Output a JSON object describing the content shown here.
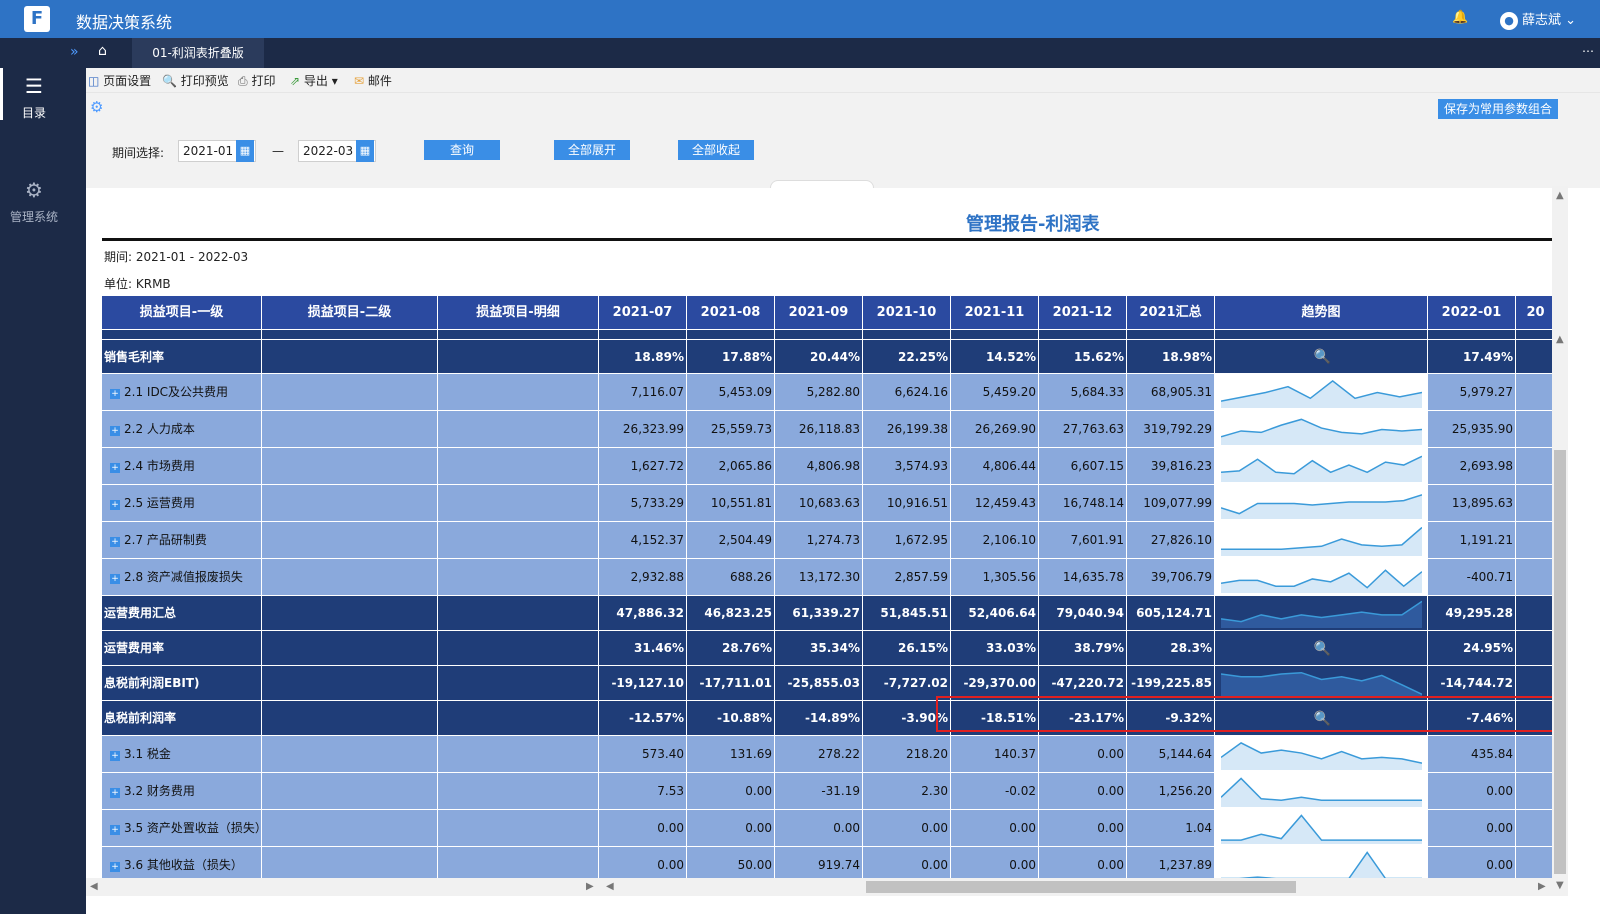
{
  "app": {
    "title": "数据决策系统",
    "logo": "F",
    "user": "薛志斌"
  },
  "sidebar": {
    "items": [
      {
        "label": "目录",
        "icon": "list-icon"
      },
      {
        "label": "管理系统",
        "icon": "gear-icon"
      }
    ]
  },
  "tabs": {
    "active": "01-利润表折叠版"
  },
  "toolbar": {
    "page_setup": "页面设置",
    "print_preview": "打印预览",
    "print": "打印",
    "export": "导出",
    "mail": "邮件"
  },
  "params": {
    "label": "期间选择:",
    "start": "2021-01",
    "separator": "—",
    "end": "2022-03",
    "query": "查询",
    "expand_all": "全部展开",
    "collapse_all": "全部收起",
    "save": "保存为常用参数组合"
  },
  "report": {
    "title": "管理报告-利润表",
    "period": "期间:  2021-01 - 2022-03",
    "unit": "单位:  KRMB",
    "headers": [
      "损益项目-一级",
      "损益项目-二级",
      "损益项目-明细",
      "2021-07",
      "2021-08",
      "2021-09",
      "2021-10",
      "2021-11",
      "2021-12",
      "2021汇总",
      "趋势图",
      "2022-01",
      "20"
    ],
    "rows": [
      {
        "type": "dark",
        "label": "销售毛利率",
        "values": [
          "18.89%",
          "17.88%",
          "20.44%",
          "22.25%",
          "14.52%",
          "15.62%",
          "18.98%"
        ],
        "next": "17.49%",
        "trend": "none"
      },
      {
        "type": "light",
        "label": "2.1 IDC及公共费用",
        "values": [
          "7,116.07",
          "5,453.09",
          "5,282.80",
          "6,624.16",
          "5,459.20",
          "5,684.33",
          "68,905.31"
        ],
        "next": "5,979.27",
        "trend": "area"
      },
      {
        "type": "light",
        "label": "2.2 人力成本",
        "values": [
          "26,323.99",
          "25,559.73",
          "26,118.83",
          "26,199.38",
          "26,269.90",
          "27,763.63",
          "319,792.29"
        ],
        "next": "25,935.90",
        "trend": "area"
      },
      {
        "type": "light",
        "label": "2.4 市场费用",
        "values": [
          "1,627.72",
          "2,065.86",
          "4,806.98",
          "3,574.93",
          "4,806.44",
          "6,607.15",
          "39,816.23"
        ],
        "next": "2,693.98",
        "trend": "area"
      },
      {
        "type": "light",
        "label": "2.5 运营费用",
        "values": [
          "5,733.29",
          "10,551.81",
          "10,683.63",
          "10,916.51",
          "12,459.43",
          "16,748.14",
          "109,077.99"
        ],
        "next": "13,895.63",
        "trend": "area"
      },
      {
        "type": "light",
        "label": "2.7 产品研制费",
        "values": [
          "4,152.37",
          "2,504.49",
          "1,274.73",
          "1,672.95",
          "2,106.10",
          "7,601.91",
          "27,826.10"
        ],
        "next": "1,191.21",
        "trend": "area"
      },
      {
        "type": "light",
        "label": "2.8 资产减值报废损失",
        "values": [
          "2,932.88",
          "688.26",
          "13,172.30",
          "2,857.59",
          "1,305.56",
          "14,635.78",
          "39,706.79"
        ],
        "next": "-400.71",
        "trend": "area"
      },
      {
        "type": "dark",
        "label": "运营费用汇总",
        "values": [
          "47,886.32",
          "46,823.25",
          "61,339.27",
          "51,845.51",
          "52,406.64",
          "79,040.94",
          "605,124.71"
        ],
        "next": "49,295.28",
        "trend": "area"
      },
      {
        "type": "dark",
        "label": "运营费用率",
        "values": [
          "31.46%",
          "28.76%",
          "35.34%",
          "26.15%",
          "33.03%",
          "38.79%",
          "28.3%"
        ],
        "next": "24.95%",
        "trend": "none"
      },
      {
        "type": "dark",
        "label": "息税前利润EBIT)",
        "values": [
          "-19,127.10",
          "-17,711.01",
          "-25,855.03",
          "-7,727.02",
          "-29,370.00",
          "-47,220.72",
          "-199,225.85"
        ],
        "next": "-14,744.72",
        "trend": "area"
      },
      {
        "type": "dark",
        "label": "息税前利润率",
        "values": [
          "-12.57%",
          "-10.88%",
          "-14.89%",
          "-3.90%",
          "-18.51%",
          "-23.17%",
          "-9.32%"
        ],
        "next": "-7.46%",
        "trend": "none"
      },
      {
        "type": "light",
        "label": "3.1 税金",
        "values": [
          "573.40",
          "131.69",
          "278.22",
          "218.20",
          "140.37",
          "0.00",
          "5,144.64"
        ],
        "next": "435.84",
        "trend": "area"
      },
      {
        "type": "light",
        "label": "3.2 财务费用",
        "values": [
          "7.53",
          "0.00",
          "-31.19",
          "2.30",
          "-0.02",
          "0.00",
          "1,256.20"
        ],
        "next": "0.00",
        "trend": "area"
      },
      {
        "type": "light",
        "label": "3.5 资产处置收益（损失）",
        "values": [
          "0.00",
          "0.00",
          "0.00",
          "0.00",
          "0.00",
          "0.00",
          "1.04"
        ],
        "next": "0.00",
        "trend": "area"
      },
      {
        "type": "light",
        "label": "3.6 其他收益（损失）",
        "values": [
          "0.00",
          "50.00",
          "919.74",
          "0.00",
          "0.00",
          "0.00",
          "1,237.89"
        ],
        "next": "0.00",
        "trend": "area"
      }
    ],
    "trend_series": [
      [],
      [
        0.2,
        0.35,
        0.5,
        0.7,
        0.3,
        0.9,
        0.3,
        0.5,
        0.35,
        0.5
      ],
      [
        0.25,
        0.45,
        0.4,
        0.65,
        0.85,
        0.55,
        0.4,
        0.35,
        0.5,
        0.45,
        0.5
      ],
      [
        0.3,
        0.35,
        0.75,
        0.3,
        0.25,
        0.7,
        0.3,
        0.55,
        0.3,
        0.65,
        0.55,
        0.85
      ],
      [
        0.35,
        0.15,
        0.5,
        0.5,
        0.5,
        0.45,
        0.5,
        0.55,
        0.55,
        0.55,
        0.6,
        0.8
      ],
      [
        0.2,
        0.2,
        0.2,
        0.2,
        0.25,
        0.3,
        0.55,
        0.35,
        0.3,
        0.35,
        0.95
      ],
      [
        0.3,
        0.4,
        0.4,
        0.2,
        0.2,
        0.45,
        0.35,
        0.65,
        0.15,
        0.75,
        0.2,
        0.7
      ],
      [
        0.3,
        0.2,
        0.45,
        0.3,
        0.45,
        0.35,
        0.45,
        0.55,
        0.45,
        0.45,
        0.95
      ],
      [],
      [
        0.85,
        0.75,
        0.75,
        0.85,
        0.9,
        0.65,
        0.75,
        0.6,
        0.8,
        0.45,
        0.1
      ],
      [],
      [
        0.4,
        0.9,
        0.55,
        0.65,
        0.55,
        0.35,
        0.6,
        0.35,
        0.4,
        0.35,
        0.2
      ],
      [
        0.3,
        0.95,
        0.25,
        0.2,
        0.3,
        0.2,
        0.2,
        0.2,
        0.2,
        0.2,
        0.2
      ],
      [
        0.1,
        0.1,
        0.3,
        0.15,
        0.95,
        0.1,
        0.1,
        0.1,
        0.1,
        0.1,
        0.1
      ],
      [
        0.05,
        0.05,
        0.1,
        0.05,
        0.05,
        0.05,
        0.05,
        0.05,
        0.95,
        0.05,
        0.05,
        0.05
      ]
    ]
  },
  "colors": {
    "accent": "#3a8ee6",
    "dark_row": "#1f3d78",
    "light_row": "#8aa9dc",
    "header": "#2b4aa0",
    "spark_line": "#3a9ad9",
    "highlight": "#e02020"
  }
}
